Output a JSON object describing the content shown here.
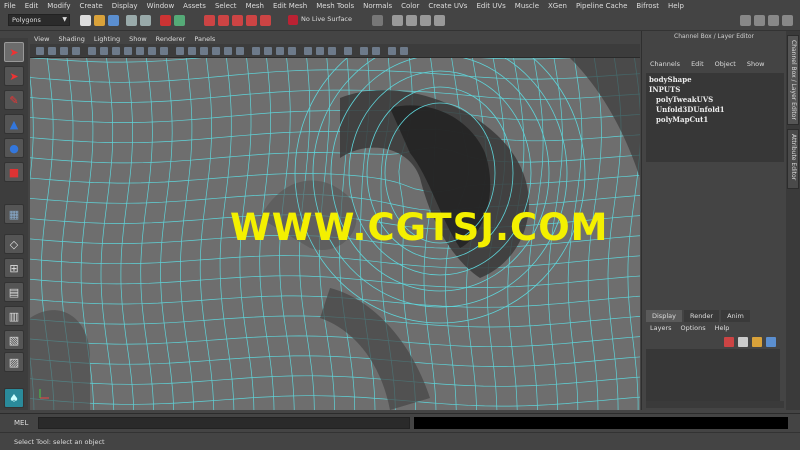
{
  "menubar": [
    "File",
    "Edit",
    "Modify",
    "Create",
    "Display",
    "Window",
    "Assets",
    "Select",
    "Mesh",
    "Edit Mesh",
    "Mesh Tools",
    "Normals",
    "Color",
    "Create UVs",
    "Edit UVs",
    "Muscle",
    "XGen",
    "Pipeline Cache",
    "Bifrost",
    "Help"
  ],
  "status_line": {
    "mode": "Polygons",
    "live_surface": "No Live Surface"
  },
  "viewport_menu": [
    "View",
    "Shading",
    "Lighting",
    "Show",
    "Renderer",
    "Panels"
  ],
  "watermark": "WWW.CGTSJ.COM",
  "channel_box": {
    "header": "Channel Box / Layer Editor",
    "menu": [
      "Channels",
      "Edit",
      "Object",
      "Show"
    ],
    "node": "bodyShape",
    "inputs_label": "INPUTS",
    "inputs": [
      "polyTweakUVS",
      "Unfold3DUnfold1",
      "polyMapCut1"
    ]
  },
  "layer_editor": {
    "tabs": [
      "Display",
      "Render",
      "Anim"
    ],
    "menu": [
      "Layers",
      "Options",
      "Help"
    ]
  },
  "side_tabs": [
    "Channel Box / Layer Editor",
    "Attribute Editor"
  ],
  "command_line": {
    "label": "MEL"
  },
  "help_line": "Select Tool: select an object",
  "colors": {
    "wire": "#5fd4d9",
    "mesh": "#6e6e6e",
    "dark_face": "#232323",
    "watermark": "#f4f000"
  }
}
